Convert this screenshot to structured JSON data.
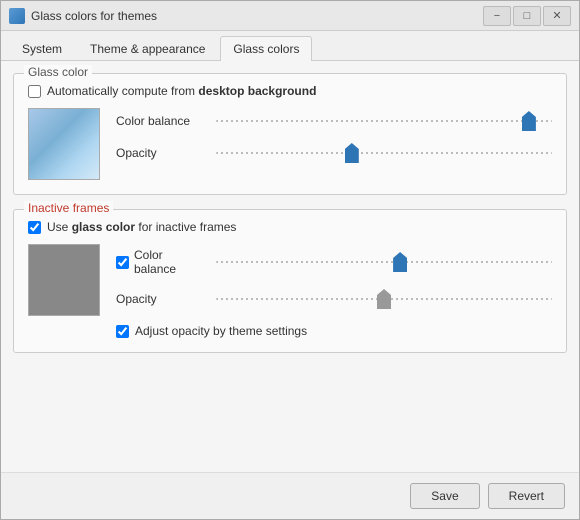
{
  "window": {
    "title": "Glass colors for themes",
    "icon": "window-icon"
  },
  "tabs": [
    {
      "id": "system",
      "label": "System",
      "active": false
    },
    {
      "id": "theme",
      "label": "Theme & appearance",
      "active": false
    },
    {
      "id": "glass",
      "label": "Glass colors",
      "active": true
    }
  ],
  "controls": {
    "minimize": "−",
    "maximize": "□",
    "close": "✕"
  },
  "glass_color_section": {
    "title": "Glass color",
    "auto_checkbox_label": "Automatically compute from desktop background",
    "auto_checked": false,
    "color_balance_label": "Color balance",
    "opacity_label": "Opacity",
    "color_balance_value": 95,
    "opacity_value": 40
  },
  "inactive_frames_section": {
    "title": "Inactive frames",
    "use_glass_label": "Use glass color for inactive frames",
    "use_glass_checked": true,
    "color_balance_label": "Color balance",
    "opacity_label": "Opacity",
    "adjust_opacity_label": "Adjust opacity by theme settings",
    "adjust_opacity_checked": true,
    "color_balance_value": 55,
    "opacity_value": 50
  },
  "footer": {
    "save_label": "Save",
    "revert_label": "Revert"
  }
}
